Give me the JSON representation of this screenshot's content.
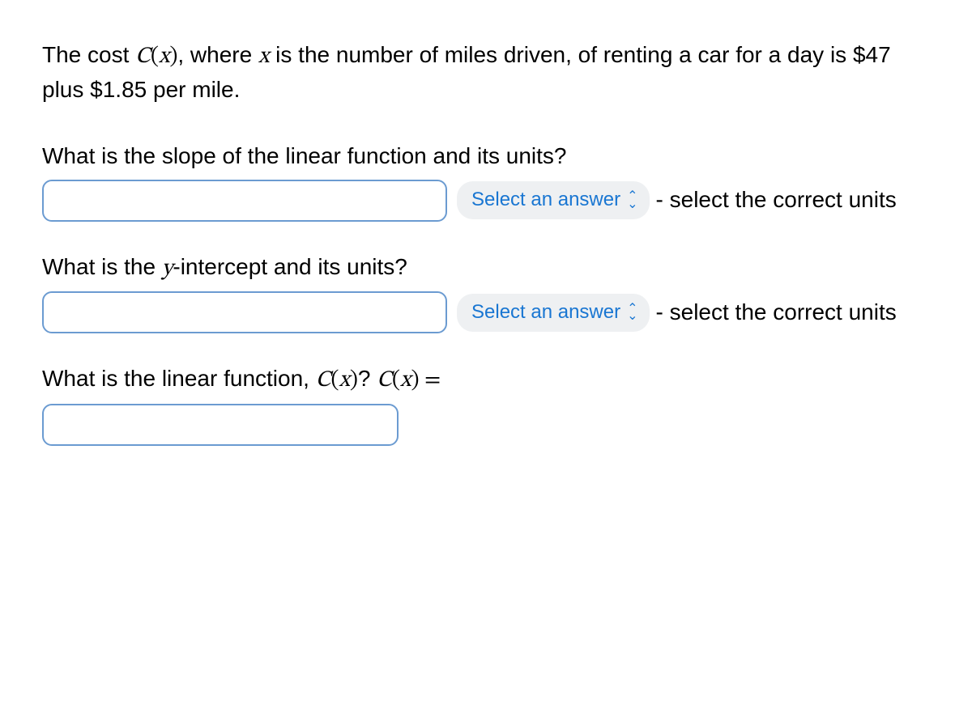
{
  "intro": {
    "text_before_Cx": "The cost ",
    "Cx_C": "C",
    "Cx_paren_open": "(",
    "Cx_x": "x",
    "Cx_paren_close": ")",
    "text_after_Cx_before_x": ", where ",
    "x_var": "x",
    "text_after_x": " is the number of miles driven, of renting a car for a day is $47 plus $1.85 per mile."
  },
  "q1": {
    "prompt": "What is the slope of the linear function and its units?",
    "input_value": "",
    "select_label": "Select an answer",
    "trailing": " - select the correct units"
  },
  "q2": {
    "prompt_before_y": "What is the ",
    "y_var": "y",
    "prompt_after_y": "-intercept and its units?",
    "input_value": "",
    "select_label": "Select an answer",
    "trailing": " - select the correct units"
  },
  "q3": {
    "prompt_before_Cx1": "What is the linear function, ",
    "C1": "C",
    "po1": "(",
    "x1": "x",
    "pc1": ")",
    "qmark": "? ",
    "C2": "C",
    "po2": "(",
    "x2": "x",
    "pc2": ")",
    "equals": " = ",
    "input_value": ""
  }
}
